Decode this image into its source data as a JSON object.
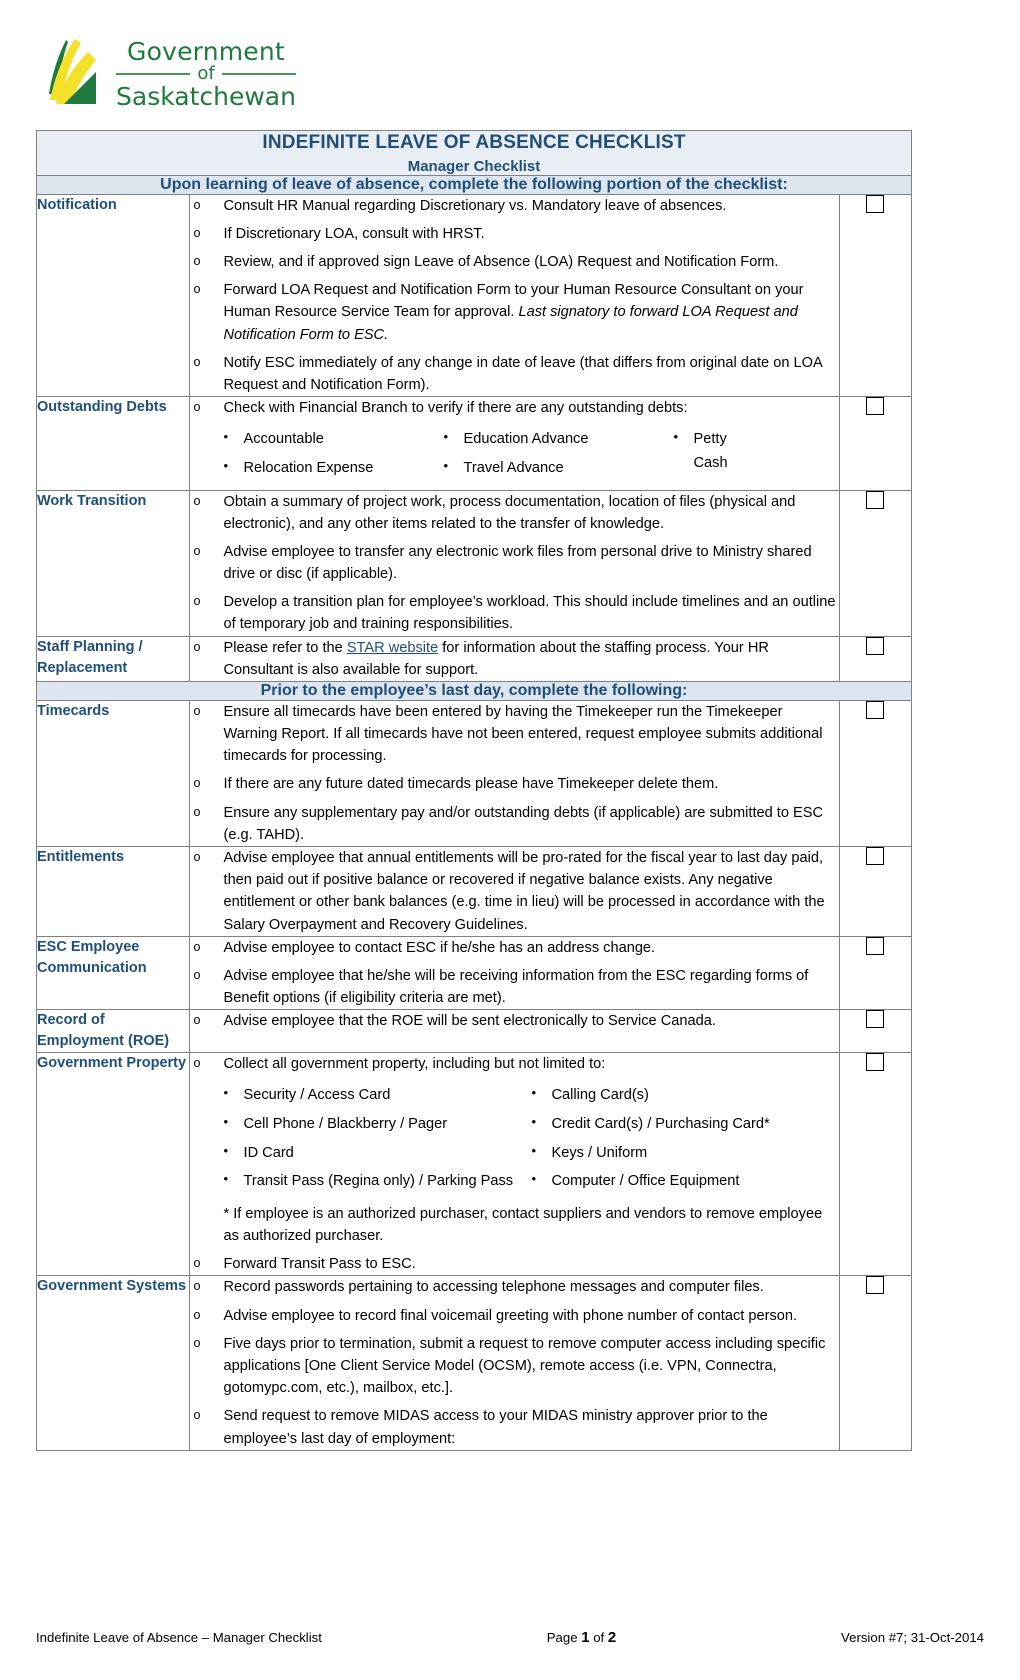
{
  "logo": {
    "line1": "Government",
    "line2": "of",
    "line3": "Saskatchewan",
    "green": "#1f7a3d",
    "yellow": "#f5e02a"
  },
  "header": {
    "title": "INDEFINITE LEAVE OF ABSENCE CHECKLIST",
    "subtitle": "Manager Checklist",
    "accent_color": "#1f4e79"
  },
  "sections": {
    "section1_banner": "Upon learning of leave of absence, complete the following portion of the checklist:",
    "section2_banner": "Prior to the employee’s last day, complete the following:"
  },
  "rows": {
    "notification": {
      "label": "Notification",
      "items": [
        "Consult HR Manual regarding Discretionary vs. Mandatory leave of absences.",
        "If Discretionary LOA, consult with HRST.",
        "Review, and if approved sign Leave of Absence (LOA) Request and Notification Form.",
        "Forward LOA Request and Notification Form to your Human Resource Consultant on your Human Resource Service Team for approval. ",
        "Notify ESC immediately of any change in date of leave (that differs from original date on LOA Request and Notification Form)."
      ],
      "item4_italic": "Last signatory to forward LOA Request and Notification Form to ESC."
    },
    "outstanding_debts": {
      "label": "Outstanding Debts",
      "lead": "Check with Financial Branch to verify if there are any outstanding debts:",
      "col1": [
        "Accountable",
        "Relocation Expense"
      ],
      "col2": [
        "Education Advance",
        "Travel Advance"
      ],
      "col3_line1": "Petty",
      "col3_line2": "Cash"
    },
    "work_transition": {
      "label": "Work Transition",
      "items": [
        "Obtain a summary of project work, process documentation, location of files (physical and electronic), and any other items related to the transfer of knowledge.",
        "Advise employee to transfer any electronic work files from personal drive to Ministry shared drive or disc (if applicable).",
        "Develop a transition plan for employee’s workload.  This should include timelines and an outline of temporary job and training responsibilities."
      ]
    },
    "staff_planning": {
      "label": "Staff Planning / Replacement",
      "text_before_link": "Please refer to the ",
      "link_text": "STAR website",
      "text_after_link": " for information about the staffing process. Your HR Consultant is also available for support."
    },
    "timecards": {
      "label": "Timecards",
      "items": [
        "Ensure all timecards have been entered by having the Timekeeper run the Timekeeper Warning Report.  If all timecards have not been entered, request employee submits additional timecards for processing.",
        " If there are any future dated timecards please have Timekeeper delete them.",
        "Ensure any supplementary pay and/or outstanding debts (if applicable) are submitted to ESC (e.g. TAHD)."
      ]
    },
    "entitlements": {
      "label": "Entitlements",
      "items": [
        "Advise employee that annual entitlements will be pro-rated for the fiscal year to last day paid, then paid out if positive balance or recovered if negative balance exists. Any negative entitlement or other bank balances (e.g. time in lieu) will be processed in accordance with the Salary Overpayment and Recovery Guidelines."
      ]
    },
    "esc_communication": {
      "label": "ESC Employee Communication",
      "items": [
        "Advise employee to contact ESC if he/she has an address change.",
        "Advise employee that he/she will be receiving information from the ESC regarding forms of Benefit options (if eligibility criteria are met)."
      ]
    },
    "roe": {
      "label": "Record of Employment (ROE)",
      "items": [
        "Advise employee that the ROE will be sent electronically to Service Canada."
      ]
    },
    "government_property": {
      "label": "Government Property",
      "lead": "Collect all government property, including but not limited to:",
      "col1": [
        "Security / Access Card",
        "Cell Phone / Blackberry / Pager",
        "ID Card",
        "Transit Pass (Regina only) / Parking Pass"
      ],
      "col2": [
        "Calling Card(s)",
        "Credit Card(s) / Purchasing Card*",
        "Keys / Uniform",
        "Computer / Office Equipment"
      ],
      "note": "* If employee is an authorized purchaser, contact suppliers and vendors to remove employee as authorized purchaser.",
      "last_item": "Forward Transit Pass to ESC."
    },
    "government_systems": {
      "label": "Government Systems",
      "items": [
        "Record passwords pertaining to accessing telephone messages and computer files.",
        "Advise employee to record final voicemail greeting with phone number of contact person.",
        "Five days prior to termination, submit a request to remove computer access including specific applications [One Client Service Model (OCSM), remote access (i.e. VPN, Connectra, gotomypc.com, etc.), mailbox, etc.].",
        "Send request to remove MIDAS access to your MIDAS ministry approver prior to the employee’s last day of employment:"
      ]
    }
  },
  "bullets": {
    "o_marker": "o",
    "dot_marker": "•"
  },
  "footer": {
    "left": "Indefinite Leave of Absence – Manager Checklist",
    "center_prefix": "Page ",
    "center_page": "1",
    "center_mid": " of ",
    "center_total": "2",
    "right": "Version #7; 31-Oct-2014"
  }
}
